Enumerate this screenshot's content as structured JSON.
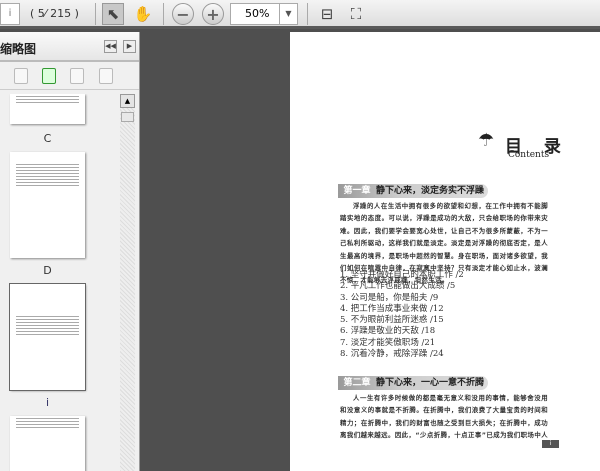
{
  "toolbar": {
    "page_value": "i",
    "page_count": "( 5⁄ 215 )",
    "zoom": "50%"
  },
  "sidebar": {
    "title": "缩略图",
    "thumbnails": [
      {
        "label": "C"
      },
      {
        "label": "D"
      },
      {
        "label": "i"
      }
    ]
  },
  "page": {
    "toc_title": "目 录",
    "toc_subtitle": "Contents",
    "chapters": [
      {
        "num": "第一章",
        "title": "静下心来，淡定务实不浮躁",
        "text": "浮躁的人在生活中拥有很多的欲望和幻想，在工作中拥有不能脚踏实地的态度。可以说，浮躁是成功的大敌，只会给职场的你带来灾难。因此，我们要学会要宽心处世，让自己不为很多所蒙蔽，不为一己私利所驱动，这样我们就是淡定。淡定是对浮躁的彻底否定，是人生最高的境界，是职场中超然的智慧。身在职场，面对诸多欲望，我们如何在喧嚣中自律，在寂寞中坚持？只有淡定才能心如止水，波澜不惊，才能够去浮戒躁，坦然生活。"
      },
      {
        "num": "第二章",
        "title": "静下心来，一心一意不折腾",
        "text": "人一生有许多时候做的都是毫无意义和没用的事情，能够舍没用和没意义的事就是不折腾。在折腾中，我们浪费了大量宝贵的时间和精力；在折腾中，我们的财富也随之受到巨大损失；在折腾中，成功离我们越来越远。因此，“少点折腾，十点正事”已成为我们职场中人在工作中的共识。而要不折"
      }
    ],
    "toc": [
      "1. 坚守并做好自己的本职工作 /2",
      "2. 平凡工作也能做出大成绩 /5",
      "3. 公司是船，你是船夫 /9",
      "4. 把工作当成事业来做 /12",
      "5. 不为眼前利益所迷惑 /15",
      "6. 浮躁是敬业的天敌 /18",
      "7. 淡定才能笑傲职场 /21",
      "8. 沉着冷静，戒除浮躁 /24"
    ],
    "page_number": "i"
  }
}
